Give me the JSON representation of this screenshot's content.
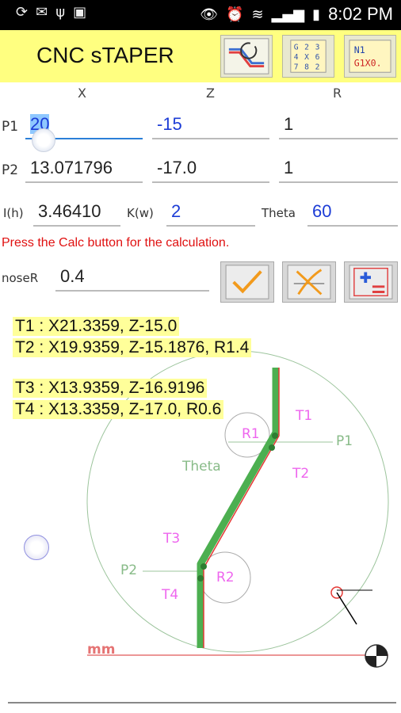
{
  "status": {
    "time": "8:02 PM"
  },
  "app": {
    "title": "CNC sTAPER"
  },
  "columns": {
    "x": "X",
    "z": "Z",
    "r": "R"
  },
  "p1": {
    "label": "P1",
    "x": "20",
    "z": "-15",
    "r": "1"
  },
  "p2": {
    "label": "P2",
    "x": "13.071796",
    "z": "-17.0",
    "r": "1"
  },
  "params": {
    "i_label": "I(h)",
    "i_value": "3.46410",
    "k_label": "K(w)",
    "k_value": "2",
    "theta_label": "Theta",
    "theta_value": "60"
  },
  "hint": "Press the Calc button for the calculation.",
  "nose": {
    "label": "noseR",
    "value": "0.4"
  },
  "results": {
    "t1": "T1 : X21.3359, Z-15.0",
    "t2": "T2 : X19.9359, Z-15.1876, R1.4",
    "t3": "T3 : X13.9359, Z-16.9196",
    "t4": "T4 : X13.3359, Z-17.0, R0.6"
  },
  "diagram": {
    "labels": {
      "p1": "P1",
      "p2": "P2",
      "r1": "R1",
      "r2": "R2",
      "t1": "T1",
      "t2": "T2",
      "t3": "T3",
      "t4": "T4",
      "theta": "Theta",
      "unit": "mm"
    },
    "colors": {
      "path": "#4caf50",
      "line": "#e53935",
      "label": "#ee66ee",
      "guide": "#88bb88"
    }
  }
}
